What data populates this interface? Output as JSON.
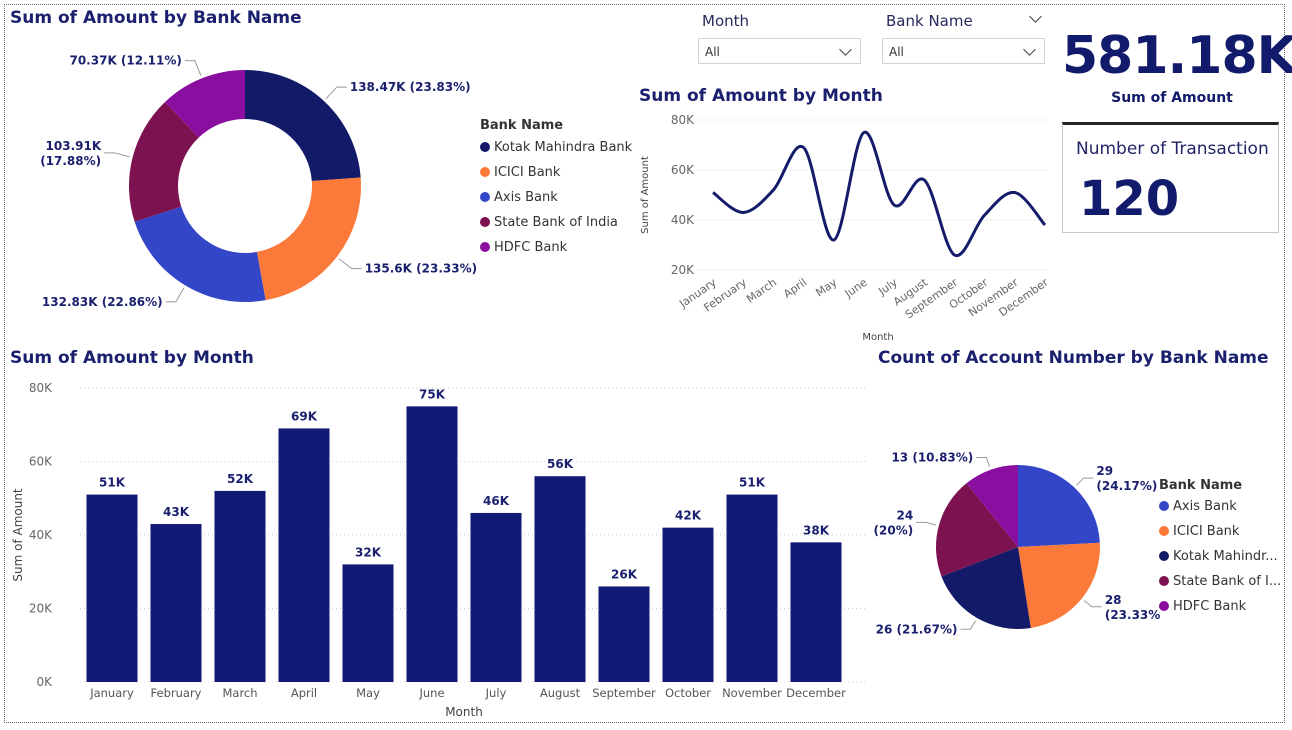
{
  "colors": {
    "kotak": "#131b68",
    "icici": "#fb7a3a",
    "axis": "#3346c8",
    "sbi": "#7d1250",
    "hdfc": "#8a0fa0",
    "bar": "#111a75",
    "line": "#151b6b",
    "title": "#1a1f6e"
  },
  "slicers": {
    "month": {
      "label": "Month",
      "value": "All"
    },
    "bank": {
      "label": "Bank Name",
      "value": "All"
    }
  },
  "kpi": {
    "value": "581.18K",
    "label": "Sum of Amount"
  },
  "card": {
    "label": "Number of Transaction",
    "value": "120"
  },
  "chart_data": [
    {
      "type": "donut",
      "title": "Sum of Amount by Bank Name",
      "legend_title": "Bank Name",
      "legend_position": "right",
      "series": [
        {
          "name": "Kotak Mahindra Bank",
          "value": 138.47,
          "label": "138.47K (23.83%)",
          "color": "#131b68"
        },
        {
          "name": "ICICI Bank",
          "value": 135.6,
          "label": "135.6K (23.33%)",
          "color": "#fb7a3a"
        },
        {
          "name": "Axis Bank",
          "value": 132.83,
          "label": "132.83K (22.86%)",
          "color": "#3346c8"
        },
        {
          "name": "State Bank of India",
          "value": 103.91,
          "label_l1": "103.91K",
          "label_l2": "(17.88%)",
          "color": "#7d1250"
        },
        {
          "name": "HDFC Bank",
          "value": 70.37,
          "label": "70.37K (12.11%)",
          "color": "#8a0fa0"
        }
      ]
    },
    {
      "type": "line",
      "title": "Sum of Amount by Month",
      "xlabel": "Month",
      "ylabel": "Sum of Amount",
      "ylim": [
        20000,
        80000
      ],
      "yticks": [
        "20K",
        "40K",
        "60K",
        "80K"
      ],
      "categories": [
        "January",
        "February",
        "March",
        "April",
        "May",
        "June",
        "July",
        "August",
        "September",
        "October",
        "November",
        "December"
      ],
      "values": [
        51000,
        43000,
        52000,
        69000,
        32000,
        75000,
        46000,
        56000,
        26000,
        42000,
        51000,
        38000
      ]
    },
    {
      "type": "bar",
      "title": "Sum of Amount by Month",
      "xlabel": "Month",
      "ylabel": "Sum of Amount",
      "ylim": [
        0,
        80000
      ],
      "yticks": [
        "0K",
        "20K",
        "40K",
        "60K",
        "80K"
      ],
      "categories": [
        "January",
        "February",
        "March",
        "April",
        "May",
        "June",
        "July",
        "August",
        "September",
        "October",
        "November",
        "December"
      ],
      "values": [
        51000,
        43000,
        52000,
        69000,
        32000,
        75000,
        46000,
        56000,
        26000,
        42000,
        51000,
        38000
      ],
      "data_labels": [
        "51K",
        "43K",
        "52K",
        "69K",
        "32K",
        "75K",
        "46K",
        "56K",
        "26K",
        "42K",
        "51K",
        "38K"
      ]
    },
    {
      "type": "pie",
      "title": "Count of Account Number by Bank Name",
      "legend_title": "Bank Name",
      "legend_position": "right",
      "series": [
        {
          "name": "Axis Bank",
          "legend": "Axis Bank",
          "value": 29,
          "label_l1": "29",
          "label_l2": "(24.17%)",
          "color": "#3346c8"
        },
        {
          "name": "ICICI Bank",
          "legend": "ICICI Bank",
          "value": 28,
          "label_l1": "28",
          "label_l2": "(23.33%)",
          "color": "#fb7a3a"
        },
        {
          "name": "Kotak Mahindra Bank",
          "legend": "Kotak Mahindr...",
          "value": 26,
          "label": "26 (21.67%)",
          "color": "#131b68"
        },
        {
          "name": "State Bank of India",
          "legend": "State Bank of I...",
          "value": 24,
          "label_l1": "24",
          "label_l2": "(20%)",
          "color": "#7d1250"
        },
        {
          "name": "HDFC Bank",
          "legend": "HDFC Bank",
          "value": 13,
          "label": "13 (10.83%)",
          "color": "#8a0fa0"
        }
      ]
    }
  ]
}
